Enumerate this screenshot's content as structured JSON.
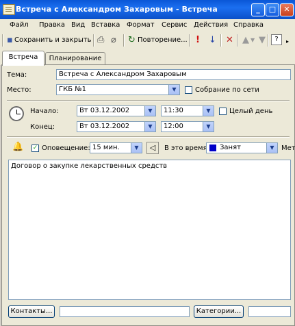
{
  "window": {
    "title": "Встреча с Александром Захаровым - Встреча"
  },
  "window_buttons": {
    "minimize": "_",
    "maximize": "□",
    "close": "✕"
  },
  "menu": [
    "Файл",
    "Правка",
    "Вид",
    "Вставка",
    "Формат",
    "Сервис",
    "Действия",
    "Справка"
  ],
  "toolbar": {
    "save_close": "Сохранить и закрыть",
    "recurrence": "Повторение..."
  },
  "tabs": [
    "Встреча",
    "Планирование"
  ],
  "form": {
    "subject_label": "Тема:",
    "subject_value": "Встреча с Александром Захаровым",
    "location_label": "Место:",
    "location_value": "ГКБ №1",
    "online_meeting_label": "Собрание по сети",
    "start_label": "Начало:",
    "start_date": "Вт 03.12.2002",
    "start_time": "11:30",
    "all_day_label": "Целый день",
    "end_label": "Конец:",
    "end_date": "Вт 03.12.2002",
    "end_time": "12:00",
    "reminder_label": "Оповещение:",
    "reminder_value": "15 мин.",
    "showtime_label": "В это время:",
    "showtime_value": "Занят",
    "showtime_color": "#0000c8",
    "label_cut": "Мет",
    "body_text": "Договор о закупке лекарственных средств"
  },
  "footer": {
    "contacts_button": "Контакты...",
    "contacts_value": "",
    "categories_button": "Категории...",
    "categories_value": ""
  }
}
